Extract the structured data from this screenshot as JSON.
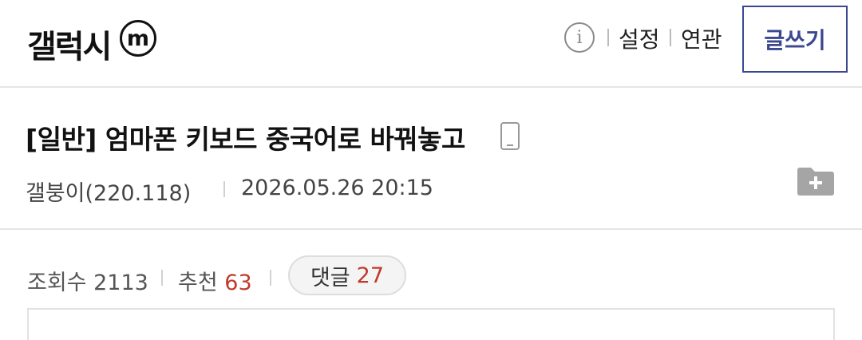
{
  "header": {
    "gallery_name": "갤럭시",
    "badge": "m",
    "info_glyph": "i",
    "links": [
      "설정",
      "연관"
    ],
    "write_label": "글쓰기"
  },
  "post": {
    "title": "[일반] 엄마폰 키보드 중국어로 바꿔놓고",
    "author": "갤붕이(220.118)",
    "date": "2026.05.26 20:15",
    "device_icon": "phone-icon",
    "folder_icon": "folder-add-icon"
  },
  "stats": {
    "views_label": "조회수",
    "views": "2113",
    "recommend_label": "추천",
    "recommend": "63",
    "comments_label": "댓글",
    "comments": "27"
  },
  "colors": {
    "accent_blue": "#3b4890",
    "count_red": "#c0392b",
    "icon_gray": "#999999"
  }
}
